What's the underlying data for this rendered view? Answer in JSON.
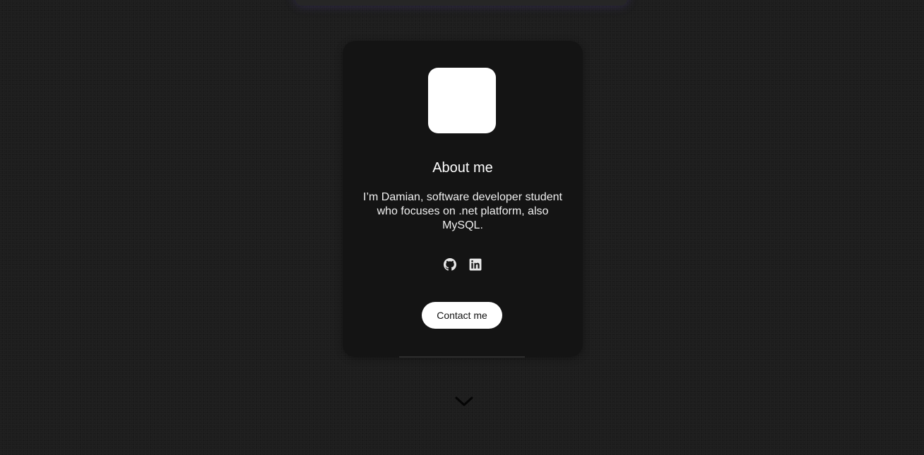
{
  "about": {
    "title": "About me",
    "description": "I’m Damian, software developer student who focuses on .net platform, also MySQL.",
    "contact_label": "Contact me"
  },
  "socials": [
    {
      "name": "github",
      "icon": "github-icon"
    },
    {
      "name": "linkedin",
      "icon": "linkedin-icon"
    }
  ],
  "scroll": {
    "icon": "chevron-down-icon"
  },
  "colors": {
    "background": "#1d1d1d",
    "card": "#141414",
    "button": "#ffffff",
    "accent_glow": "#5a46a0"
  }
}
